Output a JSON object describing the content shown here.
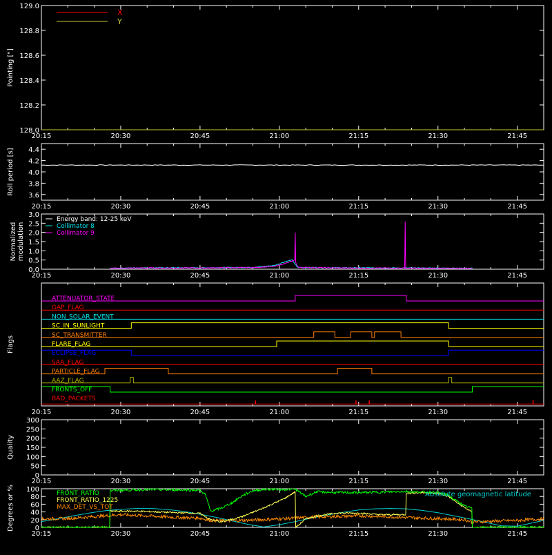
{
  "colors": {
    "axis": "#ffffff",
    "background": "#000000",
    "x_series": "#ff0000",
    "y_series": "#c8c832",
    "white": "#ffffff",
    "cyan": "#00e5ee",
    "magenta": "#ff00ff",
    "red": "#ff0000",
    "orange": "#ff7f00",
    "yellow": "#ffff00",
    "blue": "#0000ff",
    "olive": "#b0b000",
    "green": "#00ff00",
    "cyan_lat": "#00d0d0",
    "orange_mdt": "#ff8c00",
    "yellow_fr1225": "#ffff55"
  },
  "time_axis": {
    "start_min": 0,
    "end_min": 95,
    "tick_labels": [
      "20:15",
      "20:30",
      "20:45",
      "21:00",
      "21:15",
      "21:30",
      "21:45"
    ],
    "tick_positions_min": [
      0,
      15,
      30,
      45,
      60,
      75,
      90
    ]
  },
  "chart_data": [
    {
      "type": "line",
      "id": "pointing",
      "ylabel": "Pointing [\"]",
      "ylim": [
        128.0,
        129.0
      ],
      "yticks": [
        "128.0",
        "128.2",
        "128.4",
        "128.6",
        "128.8",
        "129.0"
      ],
      "legend": {
        "position": "top-left",
        "entries": [
          "X",
          "Y"
        ]
      },
      "series": [
        {
          "name": "X",
          "x": [
            0,
            95
          ],
          "values": [
            128.0,
            128.0
          ]
        },
        {
          "name": "Y",
          "x": [
            0,
            95
          ],
          "values": [
            128.0,
            128.0
          ]
        }
      ]
    },
    {
      "type": "line",
      "id": "roll",
      "ylabel": "Roll period [s]",
      "ylim": [
        3.5,
        4.5
      ],
      "yticks": [
        "3.6",
        "3.8",
        "4.0",
        "4.2",
        "4.4"
      ],
      "series": [
        {
          "x": [
            0,
            20,
            40,
            60,
            80,
            95
          ],
          "values": [
            4.12,
            4.12,
            4.12,
            4.12,
            4.12,
            4.12
          ]
        }
      ]
    },
    {
      "type": "line",
      "id": "modulation",
      "ylabel": "Normalized modulation",
      "ylim": [
        0,
        3.0
      ],
      "yticks": [
        "0.0",
        "0.5",
        "1.0",
        "1.5",
        "2.0",
        "2.5",
        "3.0"
      ],
      "legend": {
        "position": "top-left",
        "entries": [
          "Energy band: 12-25 keV",
          "Collimator 8",
          "Collimator 9"
        ]
      },
      "series": [
        {
          "name": "Collimator 8",
          "x": [
            13,
            20,
            30,
            40,
            44,
            46,
            47.5,
            48,
            48.5,
            55,
            65,
            75,
            81.5
          ],
          "values": [
            0.05,
            0.08,
            0.08,
            0.1,
            0.2,
            0.4,
            0.5,
            0.25,
            0.1,
            0.08,
            0.07,
            0.06,
            0.05
          ]
        },
        {
          "name": "Collimator 9",
          "x": [
            13,
            20,
            30,
            40,
            44,
            46,
            47.5,
            47.9,
            48.0,
            48.1,
            48.6,
            55,
            65,
            68.7,
            68.8,
            68.9,
            75,
            81.5
          ],
          "values": [
            0.05,
            0.07,
            0.07,
            0.09,
            0.15,
            0.3,
            0.45,
            0.5,
            2.0,
            0.35,
            0.1,
            0.07,
            0.06,
            0.06,
            2.6,
            0.06,
            0.05,
            0.05
          ]
        }
      ]
    },
    {
      "type": "line",
      "id": "flags",
      "ylabel": "Flags",
      "flags": [
        {
          "name": "ATTENUATOR_STATE",
          "color": "#ff00ff",
          "x": [
            0,
            48,
            48,
            69,
            69,
            95
          ],
          "values": [
            0,
            0,
            1,
            1,
            0,
            0
          ]
        },
        {
          "name": "GAP_FLAG",
          "color": "#ff0000",
          "x": [
            0,
            95
          ],
          "values": [
            0,
            0
          ]
        },
        {
          "name": "NON_SOLAR_EVENT",
          "color": "#00e5ee",
          "x": [
            0,
            95
          ],
          "values": [
            0,
            0
          ]
        },
        {
          "name": "SC_IN_SUNLIGHT",
          "color": "#ffff00",
          "x": [
            0,
            17,
            17,
            77,
            77,
            95
          ],
          "values": [
            0,
            0,
            1,
            1,
            0,
            0
          ]
        },
        {
          "name": "SC_TRANSMITTER",
          "color": "#ff7f00",
          "x": [
            0,
            51.5,
            51.5,
            55.5,
            55.5,
            58.5,
            58.5,
            62.5,
            62.5,
            63,
            63,
            68,
            68,
            95
          ],
          "values": [
            0,
            0,
            1,
            1,
            0,
            0,
            1,
            1,
            0,
            0,
            1,
            1,
            0,
            0
          ]
        },
        {
          "name": "FLARE_FLAG",
          "color": "#ffff00",
          "x": [
            0,
            44.5,
            44.5,
            77,
            77,
            95
          ],
          "values": [
            0,
            0,
            1,
            1,
            0,
            0
          ]
        },
        {
          "name": "ECLIPSE_FLAG",
          "color": "#0000ff",
          "x": [
            0,
            17,
            17,
            77,
            77,
            95
          ],
          "values": [
            1,
            1,
            0,
            0,
            1,
            1
          ]
        },
        {
          "name": "SAA_FLAG",
          "color": "#ff0000",
          "x": [
            0,
            95
          ],
          "values": [
            0,
            0
          ]
        },
        {
          "name": "PARTICLE_FLAG",
          "color": "#ff7f00",
          "x": [
            0,
            12,
            12,
            24,
            24,
            56,
            56,
            62.5,
            62.5,
            95
          ],
          "values": [
            0,
            0,
            1,
            1,
            0,
            0,
            1,
            1,
            0,
            0
          ]
        },
        {
          "name": "AAZ_FLAG",
          "color": "#b0b000",
          "x": [
            0,
            16.8,
            16.8,
            17.4,
            17.4,
            77,
            77,
            77.6,
            77.6,
            95
          ],
          "values": [
            0,
            0,
            1,
            1,
            0,
            0,
            1,
            1,
            0,
            0
          ]
        },
        {
          "name": "FRONTS_OFF",
          "color": "#00ff00",
          "x": [
            0,
            13,
            13,
            81.5,
            81.5,
            95
          ],
          "values": [
            1,
            1,
            0,
            0,
            1,
            1
          ]
        },
        {
          "name": "BAD_PACKETS",
          "color": "#ff0000",
          "spikes": [
            40.5,
            59.5,
            62,
            93
          ]
        }
      ]
    },
    {
      "type": "line",
      "id": "quality",
      "ylabel": "Quality",
      "ylim": [
        0,
        300
      ],
      "yticks": [
        "0",
        "50",
        "100",
        "150",
        "200",
        "250",
        "300"
      ],
      "series": []
    },
    {
      "type": "line",
      "id": "ratios",
      "ylabel": "Degrees or %",
      "ylim": [
        0,
        100
      ],
      "yticks": [
        "0",
        "20",
        "40",
        "60",
        "80",
        "100"
      ],
      "legend": {
        "position": "top-left",
        "entries": [
          "FRONT_RATIO",
          "FRONT_RATIO_1225",
          "MAX_DET_VS_TOT"
        ]
      },
      "annotation": "Absolute geomagnetic latitude",
      "series": [
        {
          "name": "FRONT_RATIO",
          "x": [
            0,
            12.9,
            13,
            15,
            18,
            21,
            24,
            27,
            30,
            31,
            32,
            34,
            36,
            38,
            40,
            42,
            44,
            46,
            48,
            50,
            52,
            56,
            60,
            64,
            68,
            72,
            75,
            77,
            78,
            79,
            80,
            81.4,
            81.5,
            95
          ],
          "values": [
            0,
            0,
            95,
            96,
            97,
            98,
            97,
            97,
            96,
            85,
            42,
            50,
            63,
            82,
            95,
            98,
            99,
            98,
            99,
            80,
            92,
            90,
            90,
            91,
            93,
            92,
            90,
            84,
            72,
            65,
            55,
            50,
            0,
            0
          ]
        },
        {
          "name": "FRONT_RATIO_1225",
          "x": [
            0,
            12.9,
            13,
            18,
            22,
            26,
            30,
            32,
            34,
            38,
            42,
            46,
            48,
            48.1,
            50,
            52,
            56,
            60,
            64,
            68.9,
            69,
            72,
            75,
            77,
            79,
            81.4,
            81.5,
            95
          ],
          "values": [
            0,
            0,
            42,
            42,
            40,
            38,
            36,
            20,
            14,
            28,
            50,
            75,
            92,
            0,
            22,
            30,
            37,
            37,
            33,
            33,
            88,
            90,
            88,
            80,
            60,
            40,
            0,
            0
          ]
        },
        {
          "name": "MAX_DET_VS_TOT",
          "x": [
            0,
            5,
            10,
            15,
            20,
            25,
            30,
            32,
            35,
            40,
            45,
            48,
            50,
            55,
            60,
            65,
            70,
            75,
            80,
            81.5,
            85,
            90,
            95
          ],
          "values": [
            22,
            23,
            28,
            33,
            30,
            26,
            24,
            18,
            17,
            19,
            22,
            24,
            26,
            28,
            30,
            28,
            25,
            23,
            20,
            14,
            16,
            18,
            22
          ]
        },
        {
          "name": "Absolute geomagnetic latitude",
          "x": [
            0,
            3,
            6,
            9,
            12,
            15,
            18,
            21,
            24,
            27,
            30,
            33,
            36,
            39,
            42,
            45,
            48,
            51,
            54,
            57,
            60,
            63,
            66,
            69,
            72,
            75,
            78,
            81,
            84,
            87,
            90,
            93,
            95
          ],
          "values": [
            15,
            22,
            30,
            37,
            43,
            47,
            49,
            49,
            46,
            41,
            34,
            26,
            17,
            8,
            1,
            7,
            15,
            24,
            32,
            39,
            45,
            48,
            49,
            48,
            44,
            38,
            30,
            22,
            13,
            4,
            3,
            12,
            18
          ]
        }
      ]
    }
  ]
}
